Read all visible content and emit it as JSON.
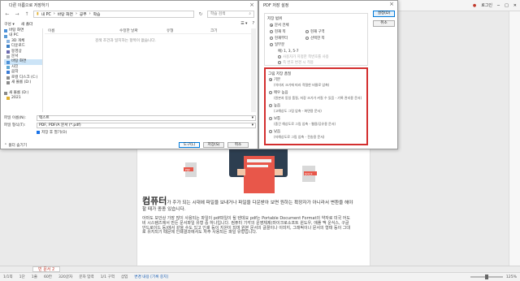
{
  "app": {
    "login_label": "로그인",
    "doc_tab": "빈 문서 2",
    "status": [
      "1/1쪽",
      "1단",
      "1줄",
      "60칸",
      "320글자",
      "문자 입력",
      "1/1 구역",
      "삽입",
      "변경 내용 [기록 중지]"
    ],
    "zoom": "125%"
  },
  "document": {
    "heading_word": "컴퓨터",
    "heading_rest": "가 주가 되는 시대에 파일을 보내거나 파일을 다운받아 보면 원하는 확장자가 아니라서 변환을 해야 할 때가 종종 있습니다.",
    "paragraph": "아마도 보안상 가장 많이 사용되는 파일이 pdf파일이 될 텐데요 pdf는 Portable Document Format의 약자로 미국 어도비 시스템즈에서 만든 문서파일 유형 중 하나입니다. 컴퓨터 기각의 운영체제(마이크로소프트 윈도우, 애플 맥 운식스, 구글 안드로이드 등)에서 같을 수도 있고 인쇄 등이 지원이 되며 원본 문서의 글꼴이나 이미지, 그래픽이나 문서의 형태 등이 그대로 유지되기 때문에 인쇄결과에서도 자주 사용되는 파일 유형입니다.",
    "badge_left": "PDF",
    "badge_right": "DOCX"
  },
  "save_dialog": {
    "title": "다른 이름으로 저장하기",
    "address": [
      "내 PC",
      "바탕 화면",
      "공부",
      "학습"
    ],
    "search_placeholder": "학습 검색",
    "toolbar": {
      "organize": "구성 ▾",
      "new_folder": "새 폴더"
    },
    "nav_items": [
      "바탕 화면",
      "내 PC",
      "3D 개체",
      "다운로드",
      "동영상",
      "문서",
      "바탕 화면",
      "사진",
      "음악",
      "로컬 디스크 (C:)",
      "새 볼륨 (D:)",
      "",
      "새 볼륨 (D:)",
      "2021"
    ],
    "columns": [
      "이름",
      "수정한 날짜",
      "유형",
      "크기"
    ],
    "empty_message": "검색 조건과 일치하는 항목이 없습니다.",
    "file_name_label": "파일 이름(N):",
    "file_name_value": "텍스트",
    "file_type_label": "파일 형식(T):",
    "file_type_value": "PDF, PDF/A 문서 (*.pdf)",
    "option_label": "저장 후 열기(O)",
    "hide_folders": "폴더 숨기기",
    "tools_button": "도구(L)",
    "save_button": "저장(S)",
    "cancel_button": "취소"
  },
  "pdf_dialog": {
    "title": "PDF 저장 설정",
    "ok_button": "설정(D)",
    "cancel_button": "취소",
    "range": {
      "title": "저장 범위",
      "all": "문서 전체",
      "current_page": "현재 쪽",
      "selection": "현재 구역",
      "current_section": "현재부터",
      "page_select": "선택한 쪽",
      "partial": "일부분",
      "page_example": "예) 1, 3, 5-7",
      "dim_1": "사용자가 지정한 쪽번호를 사용",
      "dim_2": "쪽 번호 변경 시 적용"
    },
    "quality": {
      "title": "그림 저장 품질",
      "options": [
        {
          "label": "기본",
          "desc": "(이미지 크기에 따라 적절한 비율로 압축)"
        },
        {
          "label": "매우 높음",
          "desc": "(원본과 동일 품질, 저장 크기가 커질 수 있음 - 기록 관리용 문서)"
        },
        {
          "label": "높음",
          "desc": "(고해상도 그림 압축 - 화면용 문서)"
        },
        {
          "label": "보통",
          "desc": "(중간 해상도로 그림 압축 - 웹용/공유용 문서)"
        },
        {
          "label": "낮음",
          "desc": "(저해상도로 그림 압축 - 전송용 문서)"
        }
      ],
      "selected_index": 0
    }
  },
  "colors": {
    "highlight": "#d32f2f",
    "accent": "#0078d7",
    "illus_red": "#e8574a"
  }
}
